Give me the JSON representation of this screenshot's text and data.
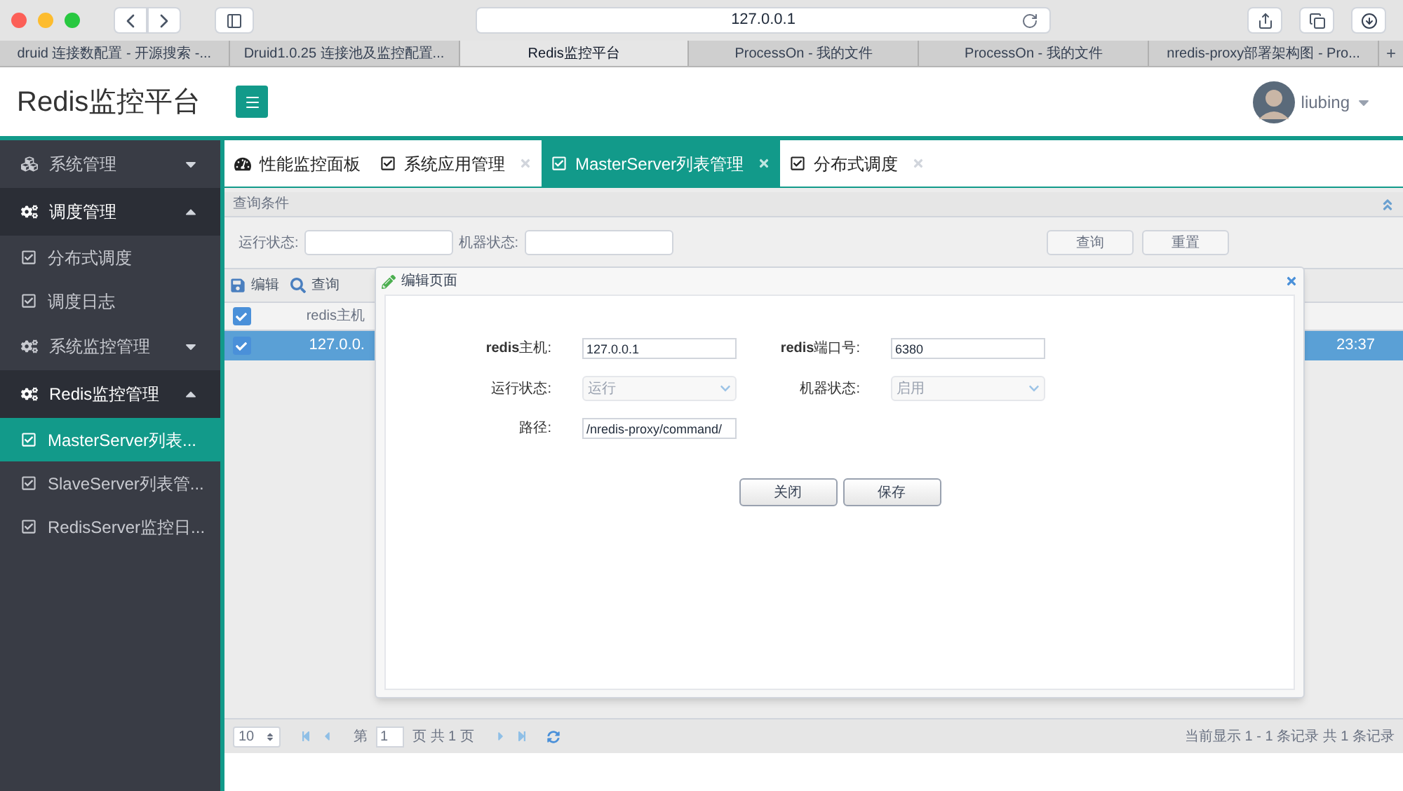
{
  "browser": {
    "address": "127.0.0.1",
    "new_tab": "+",
    "tabs": [
      {
        "label": "druid 连接数配置 - 开源搜索 -...",
        "selected": false
      },
      {
        "label": "Druid1.0.25 连接池及监控配置...",
        "selected": false
      },
      {
        "label": "Redis监控平台",
        "selected": true
      },
      {
        "label": "ProcessOn - 我的文件",
        "selected": false
      },
      {
        "label": "ProcessOn - 我的文件",
        "selected": false
      },
      {
        "label": "nredis-proxy部署架构图 - Pro...",
        "selected": false
      }
    ]
  },
  "header": {
    "title": "Redis监控平台",
    "user": "liubing"
  },
  "sidebar": {
    "items": [
      {
        "label": "系统管理",
        "expanded": false
      },
      {
        "label": "调度管理",
        "expanded": true,
        "children": [
          {
            "label": "分布式调度",
            "selected": false
          },
          {
            "label": "调度日志",
            "selected": false
          }
        ]
      },
      {
        "label": "系统监控管理",
        "expanded": false
      },
      {
        "label": "Redis监控管理",
        "expanded": true,
        "children": [
          {
            "label": "MasterServer列表...",
            "selected": true
          },
          {
            "label": "SlaveServer列表管...",
            "selected": false
          },
          {
            "label": "RedisServer监控日...",
            "selected": false
          }
        ]
      }
    ]
  },
  "content_tabs": [
    {
      "label": "性能监控面板",
      "kind": "dashboard",
      "closable": false,
      "selected": false
    },
    {
      "label": "系统应用管理",
      "kind": "check",
      "closable": true,
      "selected": false
    },
    {
      "label": "MasterServer列表管理",
      "kind": "check",
      "closable": true,
      "selected": true
    },
    {
      "label": "分布式调度",
      "kind": "check",
      "closable": true,
      "selected": false
    }
  ],
  "query_panel": {
    "title": "查询条件",
    "fields": [
      {
        "label": "运行状态:"
      },
      {
        "label": "机器状态:"
      }
    ],
    "buttons": [
      "查询",
      "重置"
    ]
  },
  "toolbar": [
    {
      "label": "编辑"
    },
    {
      "label": "查询"
    }
  ],
  "grid": {
    "header_checked": true,
    "columns": [
      "redis主机"
    ],
    "rows": [
      {
        "cells": [
          "127.0.0.",
          "23:37"
        ],
        "checked": true,
        "selected": true
      }
    ]
  },
  "pager": {
    "page_size": "10",
    "page_prefix": "第",
    "page": "1",
    "page_suffix": "页 共 1 页",
    "summary": "当前显示 1 - 1 条记录 共 1 条记录"
  },
  "dialog": {
    "title": "编辑页面",
    "fields": [
      {
        "label": "**redis**主机:",
        "value": "127.0.0.1",
        "kind": "input",
        "disabled": false
      },
      {
        "label": "**redis**端口号:",
        "value": "6380",
        "kind": "input",
        "disabled": false
      },
      {
        "label": "运行状态:",
        "value": "运行",
        "kind": "select",
        "disabled": true
      },
      {
        "label": "机器状态:",
        "value": "启用",
        "kind": "select",
        "disabled": true
      },
      {
        "label": "路径:",
        "value": "/nredis-proxy/command/",
        "kind": "input",
        "disabled": false
      }
    ],
    "buttons": [
      "关闭",
      "保存"
    ]
  }
}
